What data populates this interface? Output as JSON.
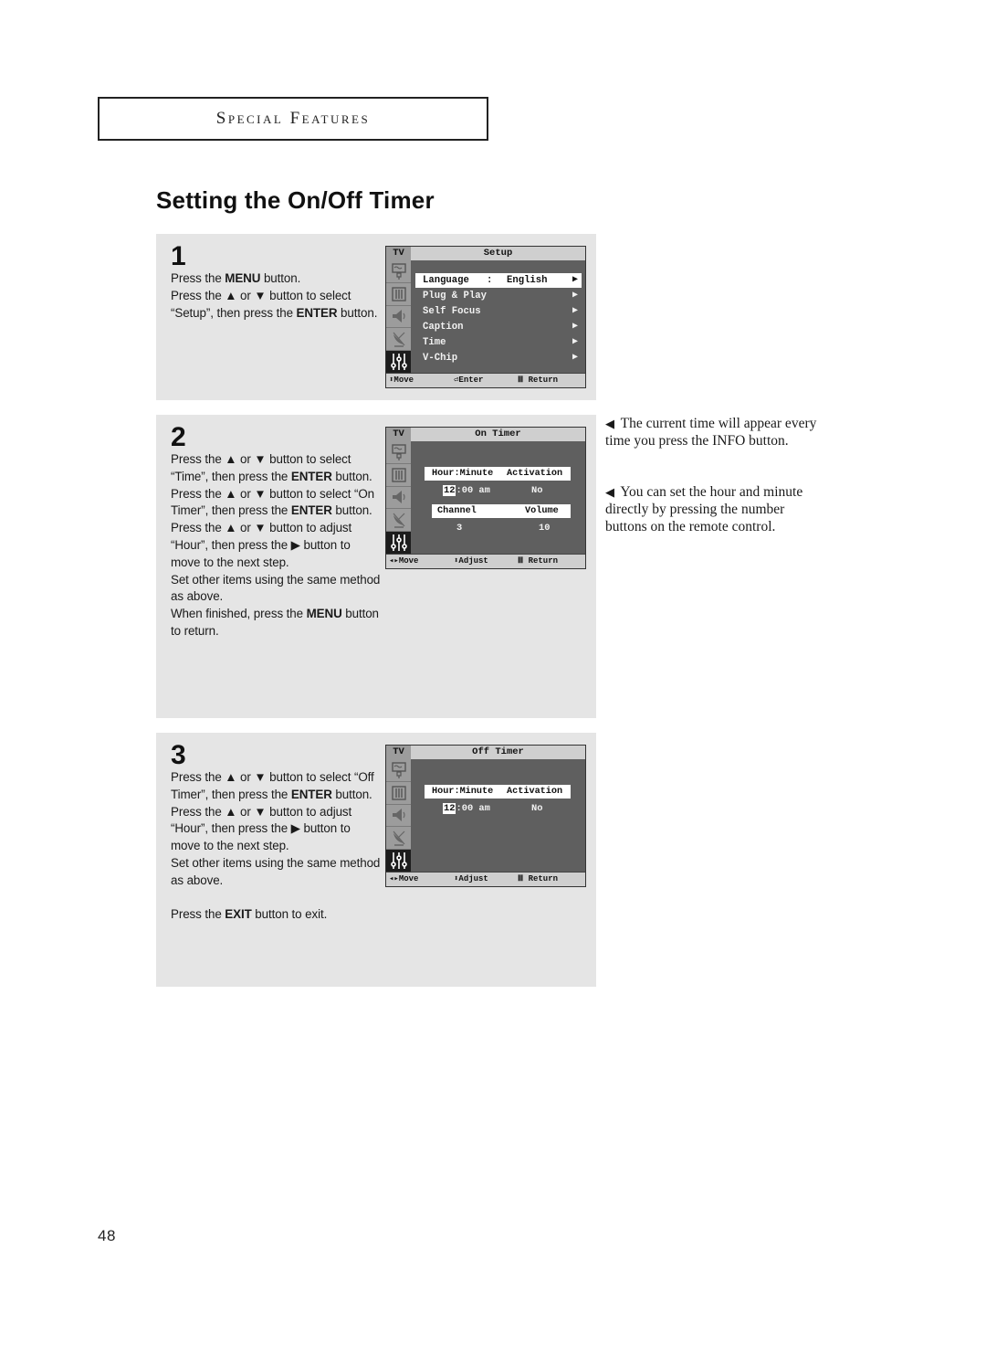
{
  "section_header": "Special Features",
  "page_title": "Setting the On/Off Timer",
  "steps": [
    {
      "number": "1",
      "text_html": "<p>Press the <b>MENU</b> button.</p><p>Press the ▲ or ▼ button to select “Setup”, then press the <b>ENTER</b> button.</p>",
      "osd": {
        "tv_label": "TV",
        "title": "Setup",
        "menu_items": [
          {
            "label": "Language",
            "separator": ":",
            "value": "English",
            "arrow": "▶",
            "selected": true
          },
          {
            "label": "Plug & Play",
            "arrow": "▶"
          },
          {
            "label": "Self Focus",
            "arrow": "▶"
          },
          {
            "label": "Caption",
            "arrow": "▶"
          },
          {
            "label": "Time",
            "arrow": "▶"
          },
          {
            "label": "V-Chip",
            "arrow": "▶"
          }
        ],
        "footer": {
          "move": "⬍Move",
          "action": "⏎Enter",
          "return": "Ⅲ Return"
        }
      }
    },
    {
      "number": "2",
      "text_html": "<p>Press the ▲ or ▼ button to select “Time”, then press the <b>ENTER</b> button.</p><p>Press the ▲ or ▼ button to select “On Timer”, then press the <b>ENTER</b> button.</p><p>Press the ▲ or ▼ button to adjust “Hour”, then press the ▶ button to move to the next step.</p><p>Set other items using the same method as above.</p><p>When finished, press the <b>MENU</b> button to return.</p>",
      "osd": {
        "tv_label": "TV",
        "title": "On Timer",
        "col_time": "Hour:Minute",
        "col_activation": "Activation",
        "hour": "12",
        "minute_suffix": ":00 am",
        "activation": "No",
        "col_channel": "Channel",
        "col_volume": "Volume",
        "channel": "3",
        "volume": "10",
        "footer": {
          "move": "◂▸Move",
          "action": "⬍Adjust",
          "return": "Ⅲ Return"
        }
      }
    },
    {
      "number": "3",
      "text_html": "<p>Press the ▲ or ▼ button to select “Off Timer”, then press the <b>ENTER</b> button.</p><p>Press the ▲ or ▼ button to adjust “Hour”, then press the ▶ button to move to the next step.</p><p>Set other items using the same method as above.</p><p class=\"gap\">Press the <b>EXIT</b> button to exit.</p>",
      "osd": {
        "tv_label": "TV",
        "title": "Off Timer",
        "col_time": "Hour:Minute",
        "col_activation": "Activation",
        "hour": "12",
        "minute_suffix": ":00 am",
        "activation": "No",
        "footer": {
          "move": "◂▸Move",
          "action": "⬍Adjust",
          "return": "Ⅲ Return"
        }
      }
    }
  ],
  "side_notes": [
    {
      "bullet": "◀",
      "text": "The current time will appear every time you press the INFO button."
    },
    {
      "bullet": "◀",
      "text": "You can set the hour and minute directly by pressing the number buttons on the remote control."
    }
  ],
  "page_number": "48",
  "osd_side_icons": [
    "picture-icon",
    "sound-bars-icon",
    "speaker-icon",
    "satellite-dish-icon",
    "setup-sliders-icon"
  ]
}
